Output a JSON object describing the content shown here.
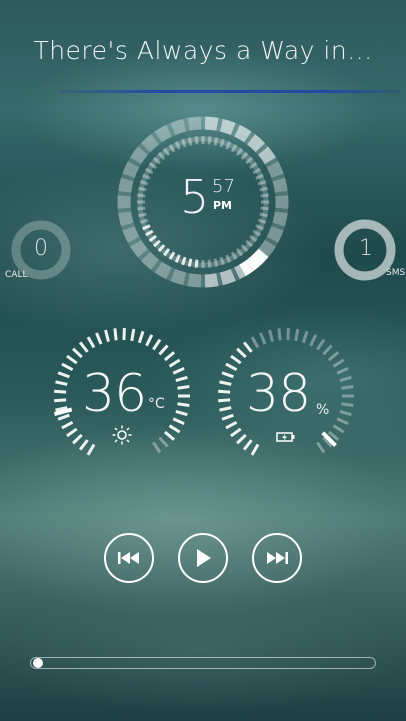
{
  "header": {
    "title": "There's Always a Way in..."
  },
  "clock": {
    "hour": "5",
    "minute": "57",
    "ampm": "PM"
  },
  "calls": {
    "count": "0",
    "label": "CALL"
  },
  "sms": {
    "count": "1",
    "label": "SMS"
  },
  "weather": {
    "temperature": "36",
    "unit": "°C",
    "icon": "sun-icon"
  },
  "battery": {
    "level": "38",
    "unit": "%",
    "icon": "battery-charging-icon",
    "fraction": 0.38
  },
  "media": {
    "prev_icon": "skip-previous-icon",
    "play_icon": "play-icon",
    "next_icon": "skip-next-icon",
    "progress": 0.0
  }
}
